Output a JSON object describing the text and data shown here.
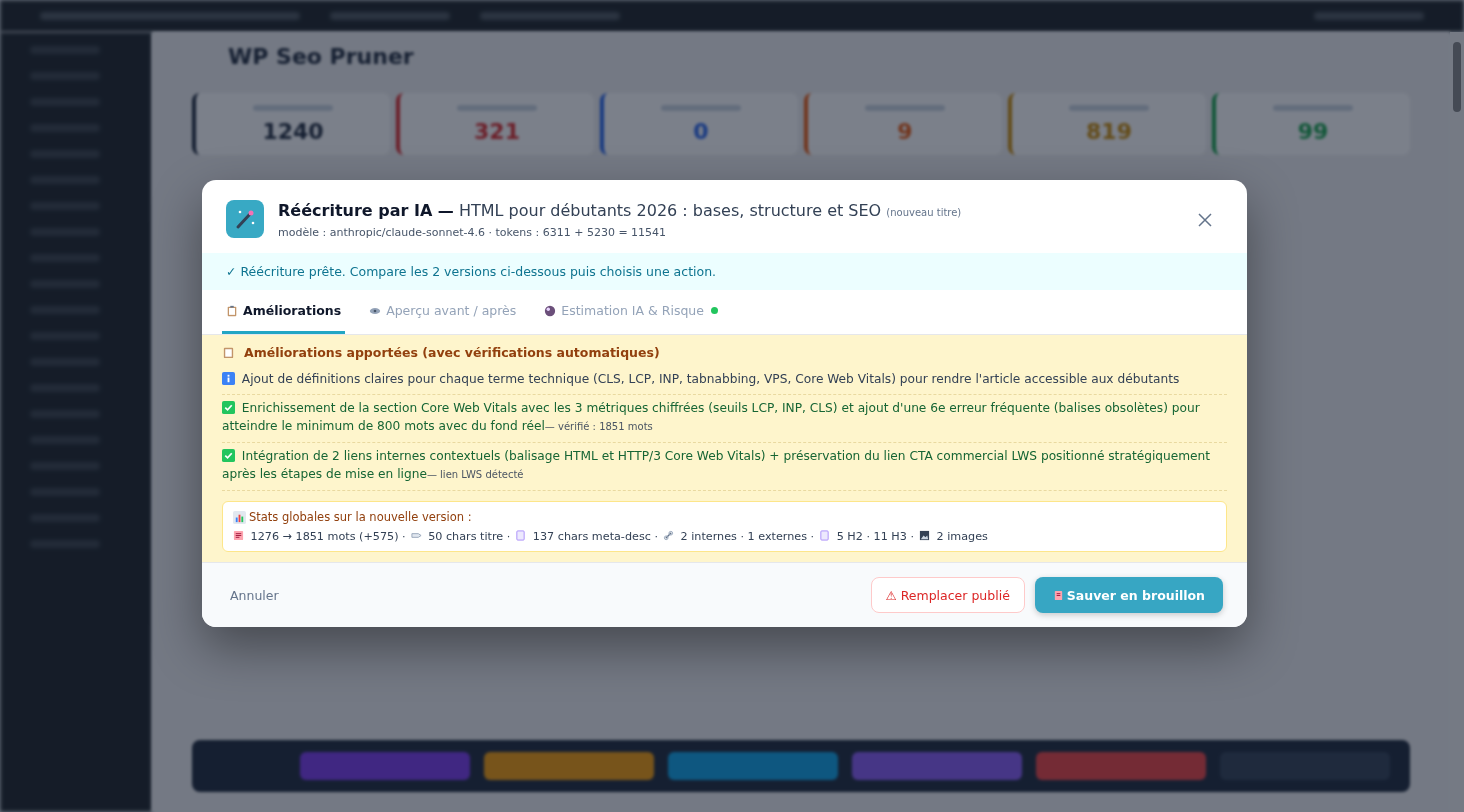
{
  "background": {
    "page_title": "WP Seo Pruner",
    "stats": [
      "1240",
      "321",
      "0",
      "9",
      "819",
      "99"
    ]
  },
  "modal": {
    "title_bold": "Réécriture par IA —",
    "title_rest": "HTML pour débutants 2026 : bases, structure et SEO",
    "title_note": "(nouveau titre)",
    "meta": "modèle : anthropic/claude-sonnet-4.6 · tokens : 6311 + 5230 = 11541",
    "banner": "✓ Réécriture prête. Compare les 2 versions ci-dessous puis choisis une action.",
    "tabs": [
      {
        "label": "Améliorations",
        "selected": true,
        "status_dot": false
      },
      {
        "label": "Aperçu avant / après",
        "selected": false,
        "status_dot": false
      },
      {
        "label": "Estimation IA & Risque",
        "selected": false,
        "status_dot": true
      }
    ],
    "section_title": "Améliorations apportées (avec vérifications automatiques)",
    "items": [
      {
        "kind": "info",
        "text": "Ajout de définitions claires pour chaque terme technique (CLS, LCP, INP, tabnabbing, VPS, Core Web Vitals) pour rendre l'article accessible aux débutants"
      },
      {
        "kind": "check",
        "text": "Enrichissement de la section Core Web Vitals avec les 3 métriques chiffrées (seuils LCP, INP, CLS) et ajout d'une 6e erreur fréquente (balises obsolètes) pour atteindre le minimum de 800 mots avec du fond réel",
        "note": "— vérifié : 1851 mots"
      },
      {
        "kind": "check",
        "text": "Intégration de 2 liens internes contextuels (balisage HTML et HTTP/3 Core Web Vitals) + préservation du lien CTA commercial LWS positionné stratégiquement après les étapes de mise en ligne",
        "note": "— lien LWS détecté"
      }
    ],
    "stats_title": "Stats globales sur la nouvelle version :",
    "stats": [
      "1276 → 1851 mots (+575) ·",
      "50 chars titre ·",
      "137 chars meta-desc ·",
      "2 internes · 1 externes ·",
      "5 H2 · 11 H3 ·",
      "2 images"
    ],
    "cancel": "Annuler",
    "replace": "⚠ Remplacer publié",
    "save": "Sauver en brouillon"
  }
}
